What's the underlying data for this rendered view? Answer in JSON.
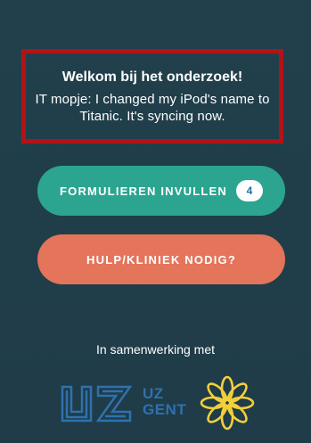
{
  "welcome": {
    "title": "Welkom bij het onderzoek!",
    "message": "IT mopje: I changed my iPod's name to Titanic. It's syncing now."
  },
  "actions": {
    "forms_label": "FORMULIEREN INVULLEN",
    "forms_badge": "4",
    "help_label": "HULP/KLINIEK NODIG?"
  },
  "footer": {
    "collab_text": "In samenwerking met",
    "logo_text_line1": "UZ",
    "logo_text_line2": "GENT"
  },
  "colors": {
    "background": "#1f3b47",
    "highlight_border": "#b31217",
    "forms_button": "#2ba590",
    "help_button": "#e4745a",
    "logo_blue": "#2f71ad",
    "flower_yellow": "#f3cf3a"
  },
  "icons": {
    "partner_logo_1": "uz-gent-logo",
    "partner_logo_2": "flower-logo"
  }
}
